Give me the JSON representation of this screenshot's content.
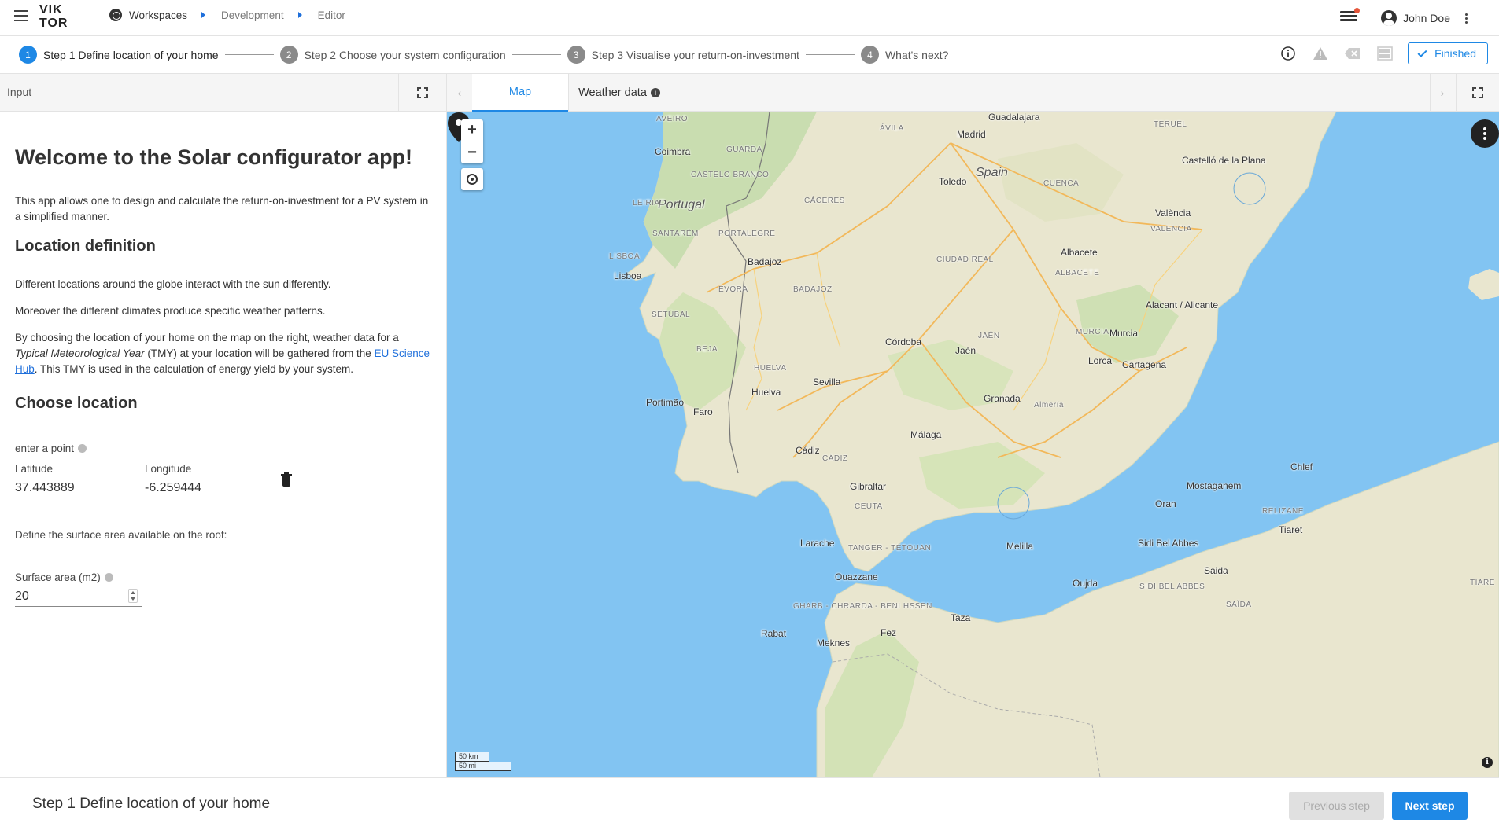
{
  "brand": {
    "logo_line1": "VIK",
    "logo_line2": "TOR"
  },
  "breadcrumb": {
    "items": [
      "Workspaces",
      "Development",
      "Editor"
    ]
  },
  "user": {
    "name": "John Doe"
  },
  "stepper": {
    "steps": [
      {
        "num": "1",
        "label": "Step 1 Define location of your home"
      },
      {
        "num": "2",
        "label": "Step 2 Choose your system configuration"
      },
      {
        "num": "3",
        "label": "Step 3 Visualise your return-on-investment"
      },
      {
        "num": "4",
        "label": "What's next?"
      }
    ],
    "active_step": 1,
    "finished_label": "Finished"
  },
  "input_panel": {
    "header": "Input",
    "title": "Welcome to the Solar configurator app!",
    "intro": "This app allows one to design and calculate the return-on-investment for a PV system in a simplified manner.",
    "section1_heading": "Location definition",
    "para1": "Different locations around the globe interact with the sun differently.",
    "para2": "Moreover the different climates produce specific weather patterns.",
    "para3_a": "By choosing the location of your home on the map on the right, weather data for a ",
    "para3_em": "Typical Meteorological Year",
    "para3_b": " (TMY) at your location will be gathered from the ",
    "para3_link": "EU Science Hub",
    "para3_c": ". This TMY is used in the calculation of energy yield by your system.",
    "section2_heading": "Choose location",
    "point_label": "enter a point",
    "latitude_label": "Latitude",
    "latitude_value": "37.443889",
    "longitude_label": "Longitude",
    "longitude_value": "-6.259444",
    "surface_prompt": "Define the surface area available on the roof:",
    "surface_label": "Surface area (m2)",
    "surface_value": "20"
  },
  "view_panel": {
    "tabs": [
      {
        "label": "Map",
        "active": true
      },
      {
        "label": "Weather data",
        "active": false
      }
    ]
  },
  "map": {
    "zoom_in": "+",
    "zoom_out": "−",
    "scale_km": "50 km",
    "scale_mi": "50 mi",
    "attribution_icon": "i",
    "labels": {
      "cities": [
        "Guadalajara",
        "Madrid",
        "Coimbra",
        "Toledo",
        "Castelló de la Plana",
        "València",
        "Badajoz",
        "Albacete",
        "Lisboa",
        "Alacant / Alicante",
        "Córdoba",
        "Jaén",
        "Murcia",
        "Lorca",
        "Cartagena",
        "Sevilla",
        "Huelva",
        "Portimão",
        "Faro",
        "Granada",
        "Almería",
        "Málaga",
        "Cádiz",
        "Gibraltar",
        "Larache",
        "Ouazzane",
        "Melilla",
        "Oran",
        "Mostaganem",
        "Chlef",
        "Tiaret",
        "Sidi Bel Abbes",
        "Saida",
        "Oujda",
        "Taza",
        "Rabat",
        "Fez",
        "Meknes"
      ],
      "countries": [
        "Spain",
        "Portugal"
      ],
      "regions": [
        "AVEIRO",
        "ÁVILA",
        "TERUEL",
        "GUARDA",
        "CASTELO BRANCO",
        "CÁCERES",
        "CUENCA",
        "LEIRIA",
        "SANTARÉM",
        "PORTALEGRE",
        "VALENCIA",
        "LISBOA",
        "CIUDAD REAL",
        "ALBACETE",
        "ÉVORA",
        "BADAJOZ",
        "SETÚBAL",
        "BEJA",
        "JAÉN",
        "MURCIA",
        "HUELVA",
        "ALMERÍA",
        "CÁDIZ",
        "CEUTA",
        "TANGER - TÉTOUAN",
        "GHARB - CHRARDA - BENI HSSEN",
        "RELIZANE",
        "TIARE",
        "SIDI BEL ABBES",
        "SAÏDA"
      ]
    }
  },
  "footer": {
    "title": "Step 1 Define location of your home",
    "prev_label": "Previous step",
    "next_label": "Next step"
  }
}
